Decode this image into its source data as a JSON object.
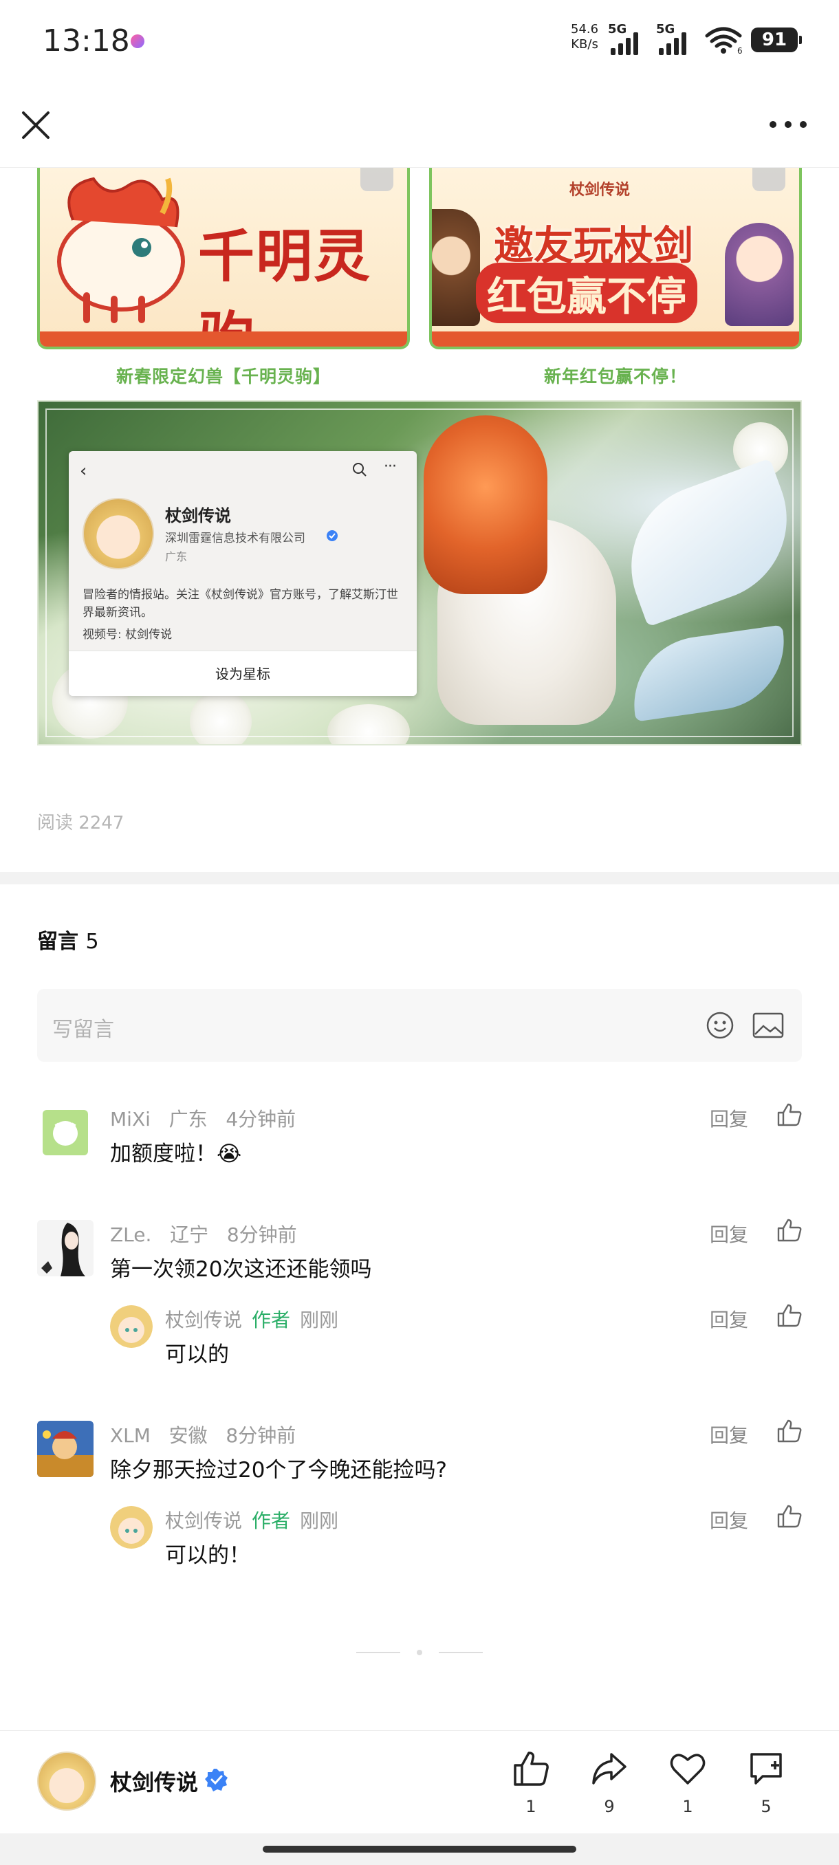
{
  "status_bar": {
    "time": "13:18",
    "net_speed_value": "54.6",
    "net_speed_unit": "KB/s",
    "signal1_label": "5G",
    "signal2_label": "5G",
    "wifi_label": "6",
    "battery": "91"
  },
  "nav": {
    "close_icon": "close-icon",
    "more_icon": "more-icon"
  },
  "banners": [
    {
      "text": "千明灵驹",
      "caption": "新春限定幻兽【千明灵驹】"
    },
    {
      "logo": "杖剑传说",
      "text_line1": "邀友玩杖剑",
      "text_line2": "红包赢不停",
      "caption": "新年红包赢不停！"
    }
  ],
  "hero": {
    "profile_card": {
      "name": "杖剑传说",
      "company": "深圳雷霆信息技术有限公司",
      "region": "广东",
      "description": "冒险者的情报站。关注《杖剑传说》官方账号，了解艾斯汀世界最新资讯。",
      "channel": "视频号: 杖剑传说",
      "star_button": "设为星标"
    }
  },
  "read_count": "阅读 2247",
  "comments_section": {
    "title": "留言",
    "count": "5",
    "input_placeholder": "写留言",
    "comments": [
      {
        "user": "MiXi",
        "region": "广东",
        "time": "4分钟前",
        "text": "加额度啦！😭",
        "reply_label": "回复"
      },
      {
        "user": "ZLe.",
        "region": "辽宁",
        "time": "8分钟前",
        "text": "第一次领20次这还还能领吗",
        "reply_label": "回复",
        "reply": {
          "user": "杖剑传说",
          "tag": "作者",
          "time": "刚刚",
          "text": "可以的",
          "reply_label": "回复"
        }
      },
      {
        "user": "XLM",
        "region": "安徽",
        "time": "8分钟前",
        "text": "除夕那天捡过20个了今晚还能捡吗?",
        "reply_label": "回复",
        "reply": {
          "user": "杖剑传说",
          "tag": "作者",
          "time": "刚刚",
          "text": "可以的！",
          "reply_label": "回复"
        }
      }
    ]
  },
  "bottom_bar": {
    "account_name": "杖剑传说",
    "like_count": "1",
    "share_count": "9",
    "favorite_count": "1",
    "comment_count": "5"
  },
  "colors": {
    "author_tag": "#2aae67",
    "banner_border": "#7ec45e",
    "caption_green": "#68b24f",
    "verified_blue": "#3b82f6"
  }
}
